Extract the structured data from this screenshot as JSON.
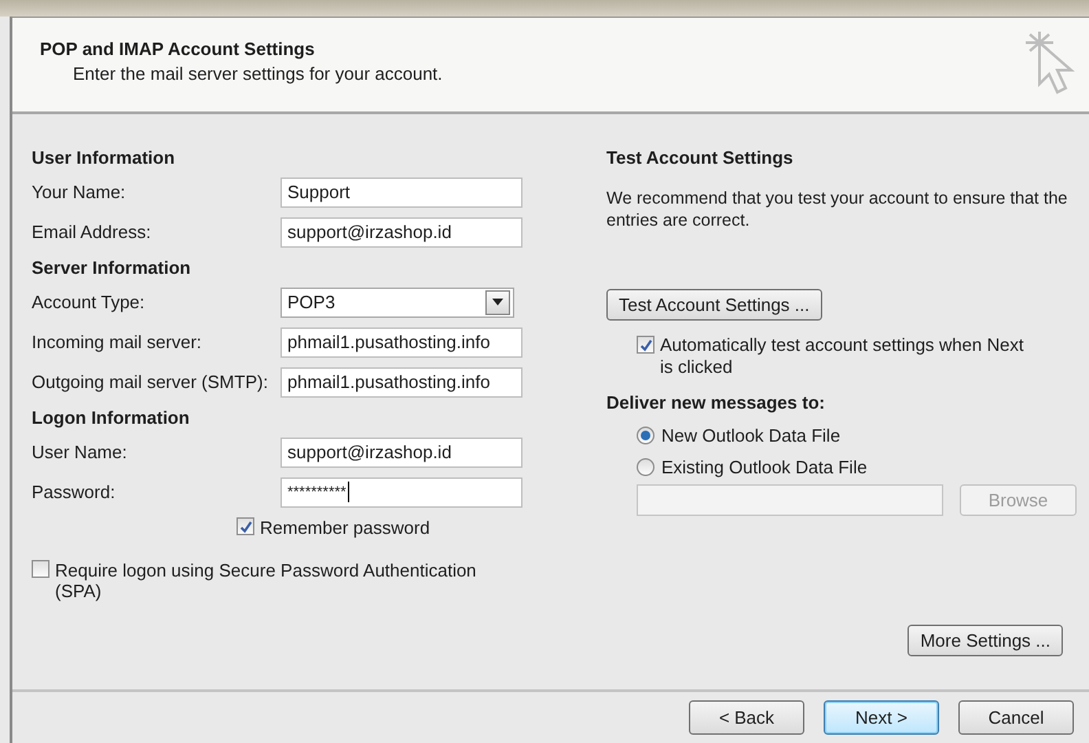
{
  "header": {
    "title": "POP and IMAP Account Settings",
    "subtitle": "Enter the mail server settings for your account."
  },
  "sections": [
    {
      "heading": "User Information",
      "fields": [
        {
          "label": "Your Name:",
          "value": "Support",
          "kind": "text"
        },
        {
          "label": "Email Address:",
          "value": "support@irzashop.id",
          "kind": "text"
        }
      ]
    },
    {
      "heading": "Server Information",
      "fields": [
        {
          "label": "Account Type:",
          "value": "POP3",
          "kind": "select"
        },
        {
          "label": "Incoming mail server:",
          "value": "phmail1.pusathosting.info",
          "kind": "text"
        },
        {
          "label": "Outgoing mail server (SMTP):",
          "value": "phmail1.pusathosting.info",
          "kind": "text"
        }
      ]
    },
    {
      "heading": "Logon Information",
      "fields": [
        {
          "label": "User Name:",
          "value": "support@irzashop.id",
          "kind": "text"
        },
        {
          "label": "Password:",
          "value": "**********",
          "kind": "password"
        }
      ]
    }
  ],
  "remember_password": {
    "label": "Remember password",
    "checked": true
  },
  "spa": {
    "label": "Require logon using Secure Password Authentication (SPA)",
    "checked": false
  },
  "test": {
    "heading": "Test Account Settings",
    "text": "We recommend that you test your account to ensure that the entries are correct.",
    "button": "Test Account Settings ...",
    "auto_test": {
      "label": "Automatically test account settings when Next is clicked",
      "checked": true
    }
  },
  "deliver": {
    "heading": "Deliver new messages to:",
    "options": [
      {
        "label": "New Outlook Data File",
        "selected": true
      },
      {
        "label": "Existing Outlook Data File",
        "selected": false
      }
    ],
    "browse_button": {
      "label": "Browse",
      "disabled": true
    }
  },
  "more_settings_button": "More Settings ...",
  "footer_buttons": [
    {
      "label": "< Back",
      "kind": "normal"
    },
    {
      "label": "Next >",
      "kind": "default"
    },
    {
      "label": "Cancel",
      "kind": "normal"
    }
  ]
}
